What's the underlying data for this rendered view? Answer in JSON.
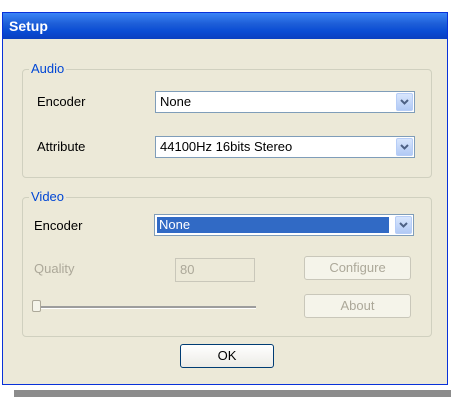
{
  "window": {
    "title": "Setup"
  },
  "audio": {
    "group_label": "Audio",
    "encoder_label": "Encoder",
    "encoder_value": "None",
    "attribute_label": "Attribute",
    "attribute_value": "44100Hz  16bits Stereo"
  },
  "video": {
    "group_label": "Video",
    "encoder_label": "Encoder",
    "encoder_value": "None",
    "quality_label": "Quality",
    "quality_value": "80",
    "configure_label": "Configure",
    "about_label": "About"
  },
  "ok_label": "OK",
  "icons": {
    "dropdown": "chevron-down-icon"
  },
  "colors": {
    "title_bar": "#0a4cd4",
    "group_label": "#0046d5",
    "selection": "#316ac5"
  }
}
